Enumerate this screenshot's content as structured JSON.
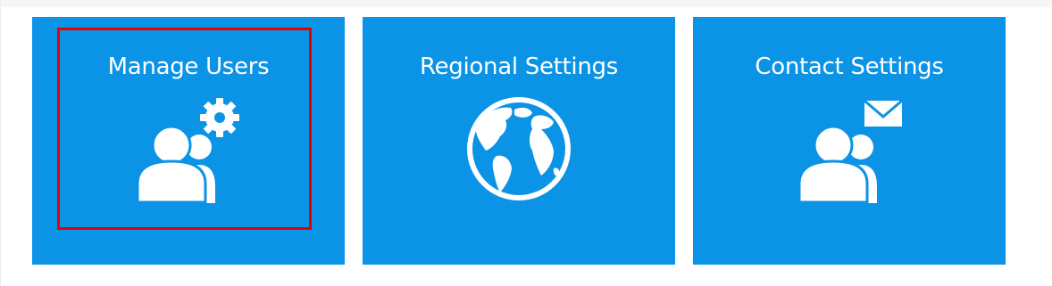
{
  "tiles": [
    {
      "title": "Manage Users",
      "icon": "users-gear-icon"
    },
    {
      "title": "Regional Settings",
      "icon": "globe-icon"
    },
    {
      "title": "Contact Settings",
      "icon": "users-envelope-icon"
    }
  ],
  "colors": {
    "tile_background": "#0b93e6",
    "tile_text": "#ffffff",
    "highlight_border": "#e60000"
  }
}
